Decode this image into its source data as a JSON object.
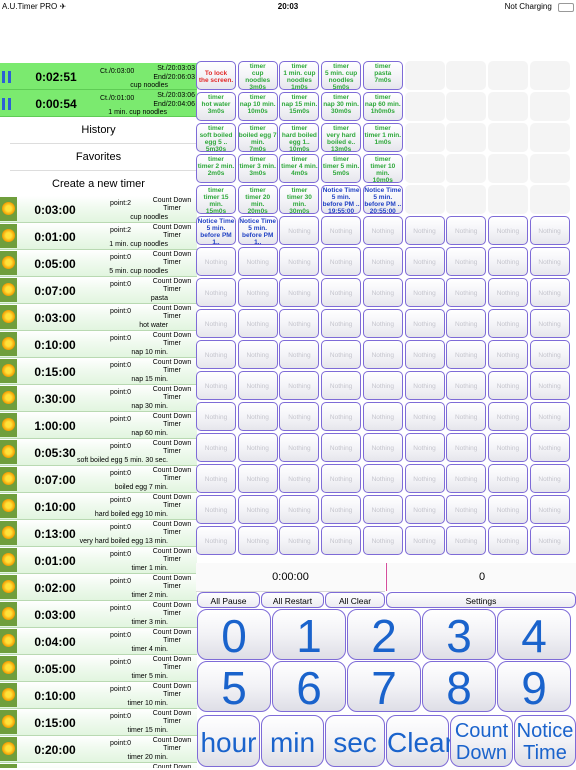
{
  "status_bar": {
    "app": "A.U.Timer PRO",
    "airplane_glyph": "✈",
    "time": "20:03",
    "battery": "Not Charging"
  },
  "running": [
    {
      "time": "0:02:51",
      "ct": "Ct./0:03:00",
      "start": "St./20:03:03",
      "end": "End/20:06:03",
      "name": "cup noodles"
    },
    {
      "time": "0:00:54",
      "ct": "Ct./0:01:00",
      "start": "St./20:03:06",
      "end": "End/20:04:06",
      "name": "1 min. cup noodles"
    }
  ],
  "menu": {
    "history": "History",
    "favorites": "Favorites",
    "create": "Create a new timer"
  },
  "timers": [
    {
      "time": "0:03:00",
      "point": "point:2",
      "type": "Count Down Timer",
      "name": "cup noodles"
    },
    {
      "time": "0:01:00",
      "point": "point:2",
      "type": "Count Down Timer",
      "name": "1 min. cup noodles"
    },
    {
      "time": "0:05:00",
      "point": "point:0",
      "type": "Count Down Timer",
      "name": "5 min. cup noodles"
    },
    {
      "time": "0:07:00",
      "point": "point:0",
      "type": "Count Down Timer",
      "name": "pasta"
    },
    {
      "time": "0:03:00",
      "point": "point:0",
      "type": "Count Down Timer",
      "name": "hot water"
    },
    {
      "time": "0:10:00",
      "point": "point:0",
      "type": "Count Down Timer",
      "name": "nap 10 min."
    },
    {
      "time": "0:15:00",
      "point": "point:0",
      "type": "Count Down Timer",
      "name": "nap 15 min."
    },
    {
      "time": "0:30:00",
      "point": "point:0",
      "type": "Count Down Timer",
      "name": "nap 30 min."
    },
    {
      "time": "1:00:00",
      "point": "point:0",
      "type": "Count Down Timer",
      "name": "nap 60 min."
    },
    {
      "time": "0:05:30",
      "point": "point:0",
      "type": "Count Down Timer",
      "name": "soft boiled egg 5 min. 30 sec."
    },
    {
      "time": "0:07:00",
      "point": "point:0",
      "type": "Count Down Timer",
      "name": "boiled egg 7 min."
    },
    {
      "time": "0:10:00",
      "point": "point:0",
      "type": "Count Down Timer",
      "name": "hard boiled egg 10 min."
    },
    {
      "time": "0:13:00",
      "point": "point:0",
      "type": "Count Down Timer",
      "name": "very hard boiled egg 13 min."
    },
    {
      "time": "0:01:00",
      "point": "point:0",
      "type": "Count Down Timer",
      "name": "timer 1 min."
    },
    {
      "time": "0:02:00",
      "point": "point:0",
      "type": "Count Down Timer",
      "name": "timer 2 min."
    },
    {
      "time": "0:03:00",
      "point": "point:0",
      "type": "Count Down Timer",
      "name": "timer 3 min."
    },
    {
      "time": "0:04:00",
      "point": "point:0",
      "type": "Count Down Timer",
      "name": "timer 4 min."
    },
    {
      "time": "0:05:00",
      "point": "point:0",
      "type": "Count Down Timer",
      "name": "timer 5 min."
    },
    {
      "time": "0:10:00",
      "point": "point:0",
      "type": "Count Down Timer",
      "name": "timer 10 min."
    },
    {
      "time": "0:15:00",
      "point": "point:0",
      "type": "Count Down Timer",
      "name": "timer 15 min."
    },
    {
      "time": "0:20:00",
      "point": "point:0",
      "type": "Count Down Timer",
      "name": "timer 20 min."
    },
    {
      "time": "",
      "point": "",
      "type": "Count Down",
      "name": ""
    }
  ],
  "tiles": [
    {
      "l1": "To lock",
      "l2": "the screen.",
      "l3": "",
      "kind": "lock"
    },
    {
      "l1": "timer",
      "l2": "cup noodles",
      "l3": "3m0s",
      "kind": "timer"
    },
    {
      "l1": "timer",
      "l2": "1 min. cup noodles",
      "l3": "1m0s",
      "kind": "timer"
    },
    {
      "l1": "timer",
      "l2": "5 min. cup noodles",
      "l3": "5m0s",
      "kind": "timer"
    },
    {
      "l1": "timer",
      "l2": "pasta",
      "l3": "7m0s",
      "kind": "timer"
    },
    {
      "l1": "timer",
      "l2": "hot water",
      "l3": "3m0s",
      "kind": "timer"
    },
    {
      "l1": "timer",
      "l2": "nap 10 min.",
      "l3": "10m0s",
      "kind": "timer"
    },
    {
      "l1": "timer",
      "l2": "nap 15 min.",
      "l3": "15m0s",
      "kind": "timer"
    },
    {
      "l1": "timer",
      "l2": "nap 30 min.",
      "l3": "30m0s",
      "kind": "timer"
    },
    {
      "l1": "timer",
      "l2": "nap 60 min.",
      "l3": "1h0m0s",
      "kind": "timer"
    },
    {
      "l1": "timer",
      "l2": "soft boiled egg 5 ..",
      "l3": "5m30s",
      "kind": "timer"
    },
    {
      "l1": "timer",
      "l2": "boiled egg 7 min.",
      "l3": "7m0s",
      "kind": "timer"
    },
    {
      "l1": "timer",
      "l2": "hard boiled egg 1..",
      "l3": "10m0s",
      "kind": "timer"
    },
    {
      "l1": "timer",
      "l2": "very hard boiled e..",
      "l3": "13m0s",
      "kind": "timer"
    },
    {
      "l1": "timer",
      "l2": "timer 1 min.",
      "l3": "1m0s",
      "kind": "timer"
    },
    {
      "l1": "timer",
      "l2": "timer 2 min.",
      "l3": "2m0s",
      "kind": "timer"
    },
    {
      "l1": "timer",
      "l2": "timer 3 min.",
      "l3": "3m0s",
      "kind": "timer"
    },
    {
      "l1": "timer",
      "l2": "timer 4 min.",
      "l3": "4m0s",
      "kind": "timer"
    },
    {
      "l1": "timer",
      "l2": "timer 5 min.",
      "l3": "5m0s",
      "kind": "timer"
    },
    {
      "l1": "timer",
      "l2": "timer 10 min.",
      "l3": "10m0s",
      "kind": "timer"
    },
    {
      "l1": "timer",
      "l2": "timer 15 min.",
      "l3": "15m0s",
      "kind": "timer"
    },
    {
      "l1": "timer",
      "l2": "timer 20 min.",
      "l3": "20m0s",
      "kind": "timer"
    },
    {
      "l1": "timer",
      "l2": "timer 30 min.",
      "l3": "30m0s",
      "kind": "timer"
    },
    {
      "l1": "Notice Time",
      "l2": "5 min. before PM ..",
      "l3": "19:55:00",
      "kind": "notice"
    },
    {
      "l1": "Notice Time",
      "l2": "5 min. before PM ..",
      "l3": "20:55:00",
      "kind": "notice"
    },
    {
      "l1": "Notice Time",
      "l2": "5 min. before PM 1..",
      "l3": "21:55:00",
      "kind": "notice"
    },
    {
      "l1": "Notice Time",
      "l2": "5 min. before PM 1..",
      "l3": "22:55:00",
      "kind": "notice"
    }
  ],
  "empty_label": "Nothing",
  "display": {
    "time": "0:00:00",
    "count": "0"
  },
  "controls": {
    "pause": "All Pause",
    "restart": "All Restart",
    "clear": "All Clear",
    "settings": "Settings"
  },
  "digits": [
    "0",
    "1",
    "2",
    "3",
    "4",
    "5",
    "6",
    "7",
    "8",
    "9"
  ],
  "units": {
    "hour": "hour",
    "min": "min",
    "sec": "sec",
    "clear": "Clear",
    "countdown_1": "Count",
    "countdown_2": "Down",
    "notice_1": "Notice",
    "notice_2": "Time"
  },
  "colors": {
    "running_bg": "#7bea6f",
    "key_text": "#1a63cc",
    "key_border": "#7e6bd7",
    "timer_text": "#2ea83a",
    "notice_text": "#2142c4",
    "lock_text": "#e12a2a"
  }
}
